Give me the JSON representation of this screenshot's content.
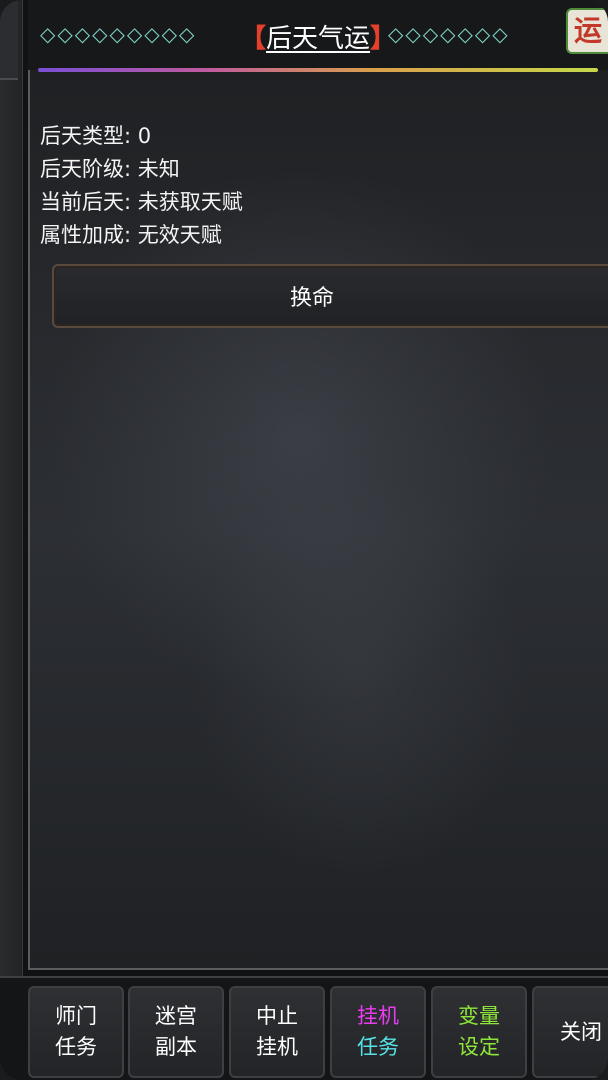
{
  "header": {
    "diamonds_left": "◇◇◇◇◇◇◇◇◇",
    "diamonds_right": "◇◇◇◇◇◇◇",
    "bracket_open": "【",
    "title": "后天气运",
    "bracket_close": "】",
    "badge_glyph": "运"
  },
  "info": {
    "rows": [
      {
        "label": "后天类型",
        "sep": ":",
        "value": "0"
      },
      {
        "label": "后天阶级",
        "sep": ":",
        "value": "未知"
      },
      {
        "label": "当前后天",
        "sep": ":",
        "value": "未获取天赋"
      },
      {
        "label": "属性加成",
        "sep": ":",
        "value": "无效天赋"
      }
    ]
  },
  "action": {
    "label": "换命"
  },
  "bottom_nav": [
    {
      "line1": "师门",
      "line2": "任务",
      "color1": "#ffffff",
      "color2": "#ffffff"
    },
    {
      "line1": "迷宫",
      "line2": "副本",
      "color1": "#ffffff",
      "color2": "#ffffff"
    },
    {
      "line1": "中止",
      "line2": "挂机",
      "color1": "#ffffff",
      "color2": "#ffffff"
    },
    {
      "line1": "挂机",
      "line2": "任务",
      "color1": "#e83cf0",
      "color2": "#56e3e8"
    },
    {
      "line1": "变量",
      "line2": "设定",
      "color1": "#8fe63a",
      "color2": "#8fe63a"
    },
    {
      "line1": "关闭",
      "line2": "",
      "color1": "#ffffff",
      "color2": "#ffffff"
    }
  ]
}
